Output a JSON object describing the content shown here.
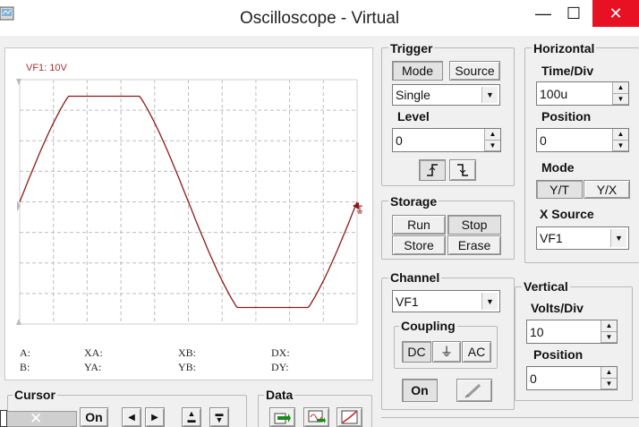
{
  "window": {
    "title": "Oscilloscope - Virtual",
    "minimize": "—",
    "maximize": "☐",
    "close": "✕"
  },
  "scope": {
    "channel_label": "VF1: 10V",
    "readouts": {
      "a": "A:",
      "b": "B:",
      "xa": "XA:",
      "ya": "YA:",
      "xb": "XB:",
      "yb": "YB:",
      "dx": "DX:",
      "dy": "DY:"
    },
    "trace_color": "#8b1a1a"
  },
  "trigger": {
    "title": "Trigger",
    "mode_label": "Mode",
    "source_label": "Source",
    "mode_value": "Single",
    "level_label": "Level",
    "level_value": "0",
    "rising_icon": "rising-edge-icon",
    "falling_icon": "falling-edge-icon"
  },
  "horizontal": {
    "title": "Horizontal",
    "time_div_label": "Time/Div",
    "time_div_value": "100u",
    "position_label": "Position",
    "position_value": "0",
    "mode_label": "Mode",
    "yt_label": "Y/T",
    "yx_label": "Y/X",
    "x_source_label": "X Source",
    "x_source_value": "VF1"
  },
  "storage": {
    "title": "Storage",
    "run": "Run",
    "stop": "Stop",
    "store": "Store",
    "erase": "Erase"
  },
  "channel": {
    "title": "Channel",
    "value": "VF1",
    "coupling_label": "Coupling",
    "dc": "DC",
    "gnd": "⏚",
    "ac": "AC",
    "on": "On"
  },
  "vertical": {
    "title": "Vertical",
    "volts_div_label": "Volts/Div",
    "volts_div_value": "10",
    "position_label": "Position",
    "position_value": "0"
  },
  "cursor": {
    "title": "Cursor",
    "on": "On",
    "close": "✕"
  },
  "data": {
    "title": "Data"
  }
}
